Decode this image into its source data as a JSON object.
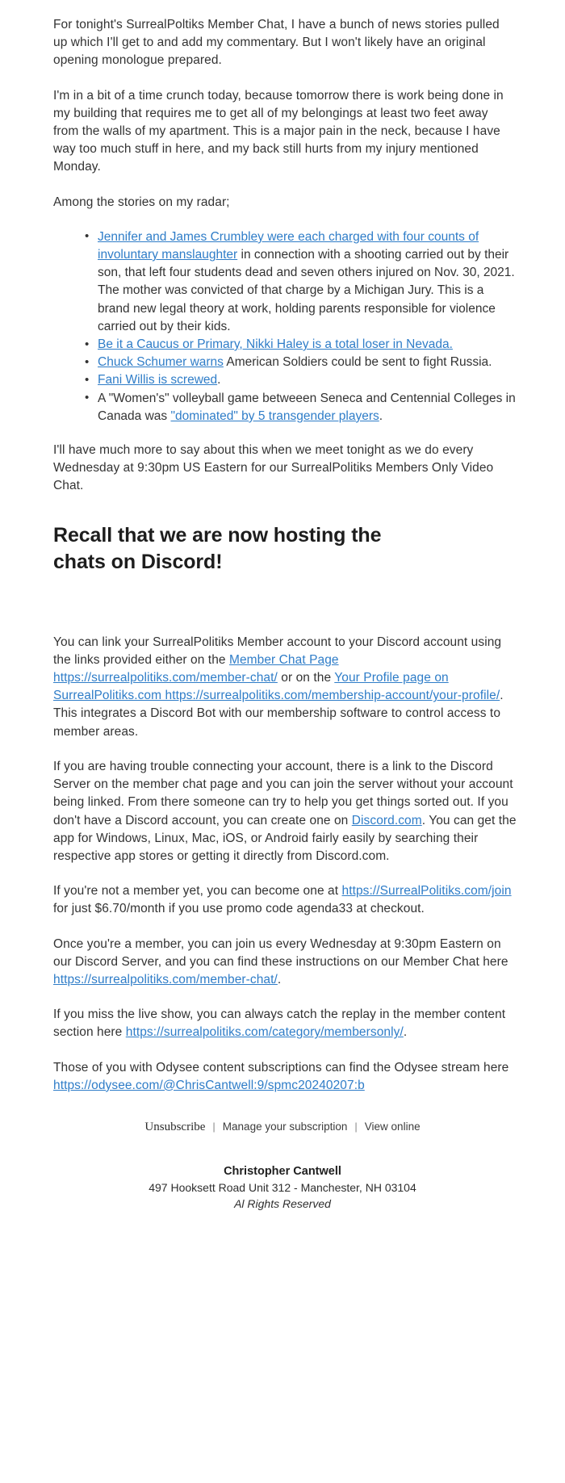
{
  "newsletter": {
    "intro_paragraphs": [
      "For tonight's SurrealPoltiks Member Chat, I have a bunch of news stories pulled up which I'll get to and add my commentary. But I won't likely have an original opening monologue prepared.",
      "I'm in a bit of a time crunch today, because tomorrow there is work being done in my building that requires me to get all of my belongings at least two feet away from the walls of my apartment. This is a major pain in the neck, because I have way too much stuff in here, and my back still hurts from my injury mentioned Monday.",
      "Among the stories on my radar;"
    ],
    "stories": [
      {
        "link_text": "Jennifer and James Crumbley were each charged with four counts of involuntary manslaughter",
        "rest_text": " in connection with a shooting carried out by their son, that left four students dead and seven others injured on Nov. 30, 2021. The mother was convicted of that charge by a Michigan Jury. This is a brand new legal theory at work, holding parents responsible for violence carried out by their kids."
      },
      {
        "link_text": "Be it a Caucus or Primary, Nikki Haley is a total loser in Nevada.",
        "rest_text": ""
      },
      {
        "link_text": "Chuck Schumer warns",
        "rest_text": " American Soldiers could be sent to fight Russia."
      },
      {
        "link_text": "Fani Willis is screwed",
        "rest_text": "."
      },
      {
        "lead_text": "A \"Women's\" volleyball game betweeen Seneca and Centennial Colleges in Canada was ",
        "link_text": "\"dominated\" by 5 transgender players",
        "rest_text": "."
      }
    ],
    "closing_paragraph": "I'll have much more to say about this when we meet tonight as we do every Wednesday at 9:30pm US Eastern for our SurrealPolitiks Members Only Video Chat.",
    "heading": "Recall that we are now hosting the chats on Discord!",
    "discord_section": {
      "link_para": {
        "part1": "You can link your SurrealPolitiks Member account to your Discord account using the links provided either on the ",
        "link1_text": "Member Chat Page https://surrealpolitiks.com/member-chat/",
        "part2": " or on the ",
        "link2_text": "Your Profile page on SurrealPolitiks.com https://surrealpolitiks.com/membership-account/your-profile/",
        "part3": ". This integrates a Discord Bot with our membership software to control access to member areas."
      },
      "trouble_para": {
        "part1": "If you are having trouble connecting your account, there is a link to the Discord Server on the member chat page and you can join the server without your account being linked. From there someone can try to help you get things sorted out. If you don't have a Discord account, you can create one on ",
        "link_text": "Discord.com",
        "part2": ". You can get the app for Windows, Linux, Mac, iOS, or Android fairly easily by searching their respective app stores or getting it directly from Discord.com."
      },
      "join_para": {
        "part1": "If you're not a member yet, you can become one at ",
        "link_text": "https://SurrealPolitiks.com/join",
        "part2": " for just $6.70/month if you use promo code agenda33 at checkout."
      },
      "member_para": {
        "part1": "Once you're a member, you can join us every Wednesday at 9:30pm Eastern on our Discord Server, and you can find these instructions on our Member Chat here ",
        "link_text": "https://surrealpolitiks.com/member-chat/",
        "part2": "."
      },
      "replay_para": {
        "part1": "If you miss the live show, you can always catch the replay in the member content section here ",
        "link_text": "https://surrealpolitiks.com/category/membersonly/",
        "part2": "."
      },
      "odysee_para": {
        "part1": "Those of you with Odysee content subscriptions can find the Odysee stream here ",
        "link_text": "https://odysee.com/@ChrisCantwell:9/spmc20240207:b",
        "part2": ""
      }
    }
  },
  "footer": {
    "unsubscribe_label": "Unsubscribe",
    "separator": "|",
    "manage_label": "Manage your subscription",
    "view_online_label": "View online",
    "sender_name": "Christopher Cantwell",
    "address": "497 Hooksett Road Unit 312 - Manchester, NH 03104",
    "rights": "Al Rights Reserved"
  },
  "colors": {
    "link": "#2f7dc8",
    "body_text": "#333333",
    "heading": "#1d1d1d",
    "background": "#ffffff"
  }
}
